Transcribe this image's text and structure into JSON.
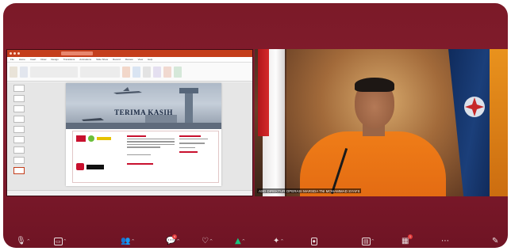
{
  "app": {
    "window_title": "",
    "accent": "#7b1a28"
  },
  "ppt": {
    "titlebar_doc": "",
    "search_placeholder": "",
    "menu": [
      "File",
      "Home",
      "Insert",
      "Draw",
      "Design",
      "Transitions",
      "Animations",
      "Slide Show",
      "Record",
      "Review",
      "View",
      "Help"
    ],
    "slide_title": "TERIMA KASIH",
    "status_left": "",
    "status_mid": ""
  },
  "video": {
    "name_label": "ASD DIREKTUR OPERASI MARSDA TNI MOHAMMAD SYAFII"
  },
  "toolbar": {
    "items": [
      {
        "icon": "microphone-icon",
        "glyph": "🎙",
        "label": ""
      },
      {
        "icon": "video-camera-icon",
        "glyph": "▭",
        "label": ""
      },
      {
        "icon": "participants-icon",
        "glyph": "👥",
        "label": ""
      },
      {
        "icon": "chat-icon",
        "glyph": "💬",
        "label": "",
        "badge": "4"
      },
      {
        "icon": "react-icon",
        "glyph": "♡",
        "label": ""
      },
      {
        "icon": "share-screen-icon",
        "glyph": "▲",
        "label": ""
      },
      {
        "icon": "apps-icon",
        "glyph": "✦",
        "label": ""
      },
      {
        "icon": "record-icon",
        "glyph": "⏺",
        "label": ""
      },
      {
        "icon": "whiteboard-icon",
        "glyph": "▤",
        "label": ""
      },
      {
        "icon": "more-apps-icon",
        "glyph": "▦",
        "label": "",
        "badge": "1"
      },
      {
        "icon": "more-icon",
        "glyph": "⋯",
        "label": ""
      },
      {
        "icon": "end-icon",
        "glyph": "✎",
        "label": ""
      }
    ]
  }
}
